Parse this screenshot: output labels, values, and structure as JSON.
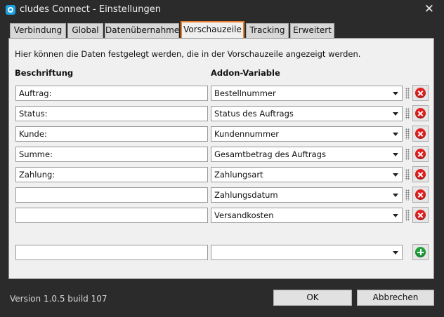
{
  "window": {
    "title": "cludes Connect - Einstellungen",
    "app_icon": "cludes-icon",
    "close_glyph": "✕"
  },
  "tabs": [
    {
      "label": "Verbindung"
    },
    {
      "label": "Global"
    },
    {
      "label": "Datenübernahme"
    },
    {
      "label": "Vorschauzeile",
      "active": true
    },
    {
      "label": "Tracking"
    },
    {
      "label": "Erweitert"
    }
  ],
  "panel": {
    "description": "Hier können die Daten festgelegt werden, die in der Vorschauzeile angezeigt werden.",
    "headers": {
      "label": "Beschriftung",
      "variable": "Addon-Variable"
    },
    "rows": [
      {
        "label": "Auftrag:",
        "variable": "Bestellnummer"
      },
      {
        "label": "Status:",
        "variable": "Status des Auftrags"
      },
      {
        "label": "Kunde:",
        "variable": "Kundennummer"
      },
      {
        "label": "Summe:",
        "variable": "Gesamtbetrag des Auftrags"
      },
      {
        "label": "Zahlung:",
        "variable": "Zahlungsart"
      },
      {
        "label": "",
        "variable": "Zahlungsdatum"
      },
      {
        "label": "",
        "variable": "Versandkosten"
      }
    ],
    "new_row": {
      "label": "",
      "variable": ""
    }
  },
  "footer": {
    "version": "Version 1.0.5 build 107",
    "ok_label": "OK",
    "cancel_label": "Abbrechen"
  },
  "colors": {
    "active_tab_border": "#e87d2e",
    "delete_icon": "#e02020",
    "add_icon": "#1ea23a",
    "chrome": "#2b2b2b"
  }
}
